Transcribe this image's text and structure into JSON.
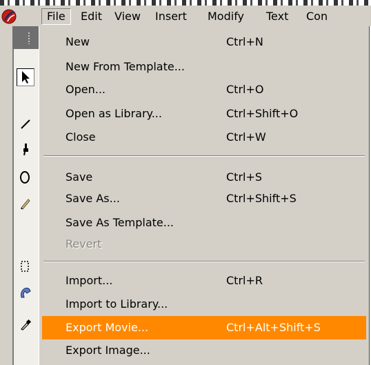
{
  "menubar": {
    "app_icon": "macromedia-logo-icon",
    "items": [
      {
        "label": "File",
        "active": true
      },
      {
        "label": "Edit"
      },
      {
        "label": "View"
      },
      {
        "label": "Insert"
      },
      {
        "label": "Modify"
      },
      {
        "label": "Text"
      },
      {
        "label": "Con"
      }
    ]
  },
  "toolbar": {
    "tools": [
      {
        "icon": "arrow-tool-icon",
        "selected": true
      },
      {
        "icon": "line-tool-icon"
      },
      {
        "icon": "lasso-tool-icon"
      },
      {
        "icon": "oval-tool-icon"
      },
      {
        "icon": "pencil-tool-icon"
      },
      {
        "icon": "text-tool-icon"
      },
      {
        "icon": "ink-bottle-tool-icon"
      },
      {
        "icon": "eyedropper-tool-icon"
      }
    ]
  },
  "file_menu": {
    "items": [
      {
        "label": "New",
        "shortcut": "Ctrl+N"
      },
      {
        "label": "New From Template...",
        "shortcut": ""
      },
      {
        "label": "Open...",
        "shortcut": "Ctrl+O"
      },
      {
        "label": "Open as Library...",
        "shortcut": "Ctrl+Shift+O"
      },
      {
        "label": "Close",
        "shortcut": "Ctrl+W"
      },
      {
        "label": "Save",
        "shortcut": "Ctrl+S"
      },
      {
        "label": "Save As...",
        "shortcut": "Ctrl+Shift+S"
      },
      {
        "label": "Save As Template...",
        "shortcut": ""
      },
      {
        "label": "Revert",
        "shortcut": "",
        "disabled": true
      },
      {
        "label": "Import...",
        "shortcut": "Ctrl+R"
      },
      {
        "label": "Import to Library...",
        "shortcut": ""
      },
      {
        "label": "Export Movie...",
        "shortcut": "Ctrl+Alt+Shift+S",
        "highlighted": true
      },
      {
        "label": "Export Image...",
        "shortcut": ""
      }
    ]
  },
  "colors": {
    "menu_bg": "#d4d0c8",
    "highlight": "#ff8800",
    "highlight_text": "#ffffff",
    "disabled_text": "#8a8782"
  }
}
